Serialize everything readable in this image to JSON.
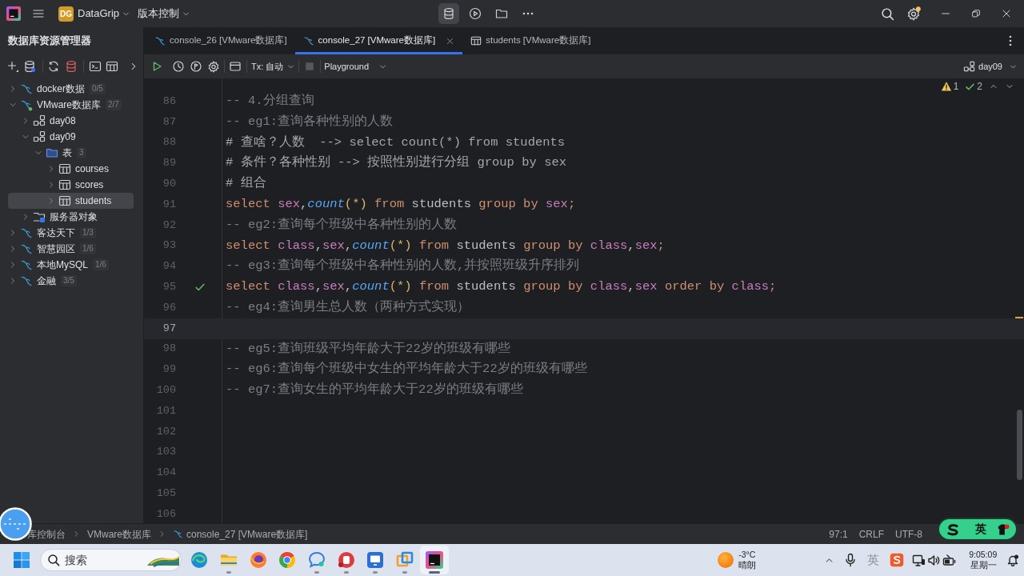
{
  "title_bar": {
    "badge": "DG",
    "project": "DataGrip",
    "menu": "版本控制"
  },
  "explorer": {
    "title": "数据库资源管理器",
    "tree": [
      {
        "kind": "datasource",
        "label": "docker数据",
        "count": "0/5",
        "expanded": false,
        "selected": false,
        "connected": false
      },
      {
        "kind": "datasource",
        "label": "VMware数据库",
        "count": "2/7",
        "expanded": true,
        "selected": false,
        "connected": true,
        "children": [
          {
            "kind": "schema",
            "label": "day08",
            "expanded": false,
            "selected": false
          },
          {
            "kind": "schema",
            "label": "day09",
            "expanded": true,
            "selected": false,
            "children": [
              {
                "kind": "folder",
                "label": "表",
                "count": "3",
                "expanded": true,
                "selected": false,
                "children": [
                  {
                    "kind": "table",
                    "label": "courses",
                    "expanded": false,
                    "selected": false
                  },
                  {
                    "kind": "table",
                    "label": "scores",
                    "expanded": false,
                    "selected": false
                  },
                  {
                    "kind": "table",
                    "label": "students",
                    "expanded": false,
                    "selected": true
                  }
                ]
              }
            ]
          },
          {
            "kind": "server",
            "label": "服务器对象",
            "expanded": false,
            "selected": false
          }
        ]
      },
      {
        "kind": "datasource",
        "label": "客达天下",
        "count": "1/3",
        "expanded": false,
        "selected": false,
        "connected": false
      },
      {
        "kind": "datasource",
        "label": "智慧园区",
        "count": "1/6",
        "expanded": false,
        "selected": false,
        "connected": false
      },
      {
        "kind": "datasource",
        "label": "本地MySQL",
        "count": "1/6",
        "expanded": false,
        "selected": false,
        "connected": false
      },
      {
        "kind": "datasource",
        "label": "金融",
        "count": "3/5",
        "expanded": false,
        "selected": false,
        "connected": false
      }
    ]
  },
  "tabs": [
    {
      "kind": "console",
      "label": "console_26 [VMware数据库]",
      "selected": false
    },
    {
      "kind": "console",
      "label": "console_27 [VMware数据库]",
      "selected": true
    },
    {
      "kind": "table",
      "label": "students [VMware数据库]",
      "selected": false
    }
  ],
  "editor_toolbar": {
    "transaction": "Tx: 自动",
    "mode": "Playground",
    "schema": "day09"
  },
  "inspections": {
    "warnings": "1",
    "passed": "2"
  },
  "lines": [
    {
      "number": "86",
      "current": false,
      "executed": false,
      "tokens": [
        {
          "kind": "comment",
          "text": "-- 4.分组查询"
        }
      ]
    },
    {
      "number": "87",
      "current": false,
      "executed": false,
      "tokens": [
        {
          "kind": "comment",
          "text": "-- eg1:查询各种性别的人数"
        }
      ]
    },
    {
      "number": "88",
      "current": false,
      "executed": false,
      "tokens": [
        {
          "kind": "hash_comment",
          "text": "# 查啥？人数  --> select count(*) from students"
        }
      ]
    },
    {
      "number": "89",
      "current": false,
      "executed": false,
      "tokens": [
        {
          "kind": "hash_comment",
          "text": "# 条件？各种性别 --> 按照性别进行分组 group by sex"
        }
      ]
    },
    {
      "number": "90",
      "current": false,
      "executed": false,
      "tokens": [
        {
          "kind": "hash_comment",
          "text": "# 组合"
        }
      ]
    },
    {
      "number": "91",
      "current": false,
      "executed": false,
      "tokens": [
        {
          "kind": "keyword",
          "text": "select "
        },
        {
          "kind": "column",
          "text": "sex"
        },
        {
          "kind": "plain",
          "text": ","
        },
        {
          "kind": "function",
          "text": "count"
        },
        {
          "kind": "paren",
          "text": "(*)"
        },
        {
          "kind": "keyword",
          "text": " from "
        },
        {
          "kind": "plain",
          "text": "students "
        },
        {
          "kind": "keyword",
          "text": "group by "
        },
        {
          "kind": "column",
          "text": "sex"
        },
        {
          "kind": "keyword",
          "text": ";"
        }
      ]
    },
    {
      "number": "92",
      "current": false,
      "executed": false,
      "tokens": [
        {
          "kind": "comment",
          "text": "-- eg2:查询每个班级中各种性别的人数"
        }
      ]
    },
    {
      "number": "93",
      "current": false,
      "executed": false,
      "tokens": [
        {
          "kind": "keyword",
          "text": "select "
        },
        {
          "kind": "column",
          "text": "class"
        },
        {
          "kind": "plain",
          "text": ","
        },
        {
          "kind": "column",
          "text": "sex"
        },
        {
          "kind": "plain",
          "text": ","
        },
        {
          "kind": "function",
          "text": "count"
        },
        {
          "kind": "paren",
          "text": "(*)"
        },
        {
          "kind": "keyword",
          "text": " from "
        },
        {
          "kind": "plain",
          "text": "students "
        },
        {
          "kind": "keyword",
          "text": "group by "
        },
        {
          "kind": "column",
          "text": "class"
        },
        {
          "kind": "plain",
          "text": ","
        },
        {
          "kind": "column",
          "text": "sex"
        },
        {
          "kind": "keyword",
          "text": ";"
        }
      ]
    },
    {
      "number": "94",
      "current": false,
      "executed": false,
      "tokens": [
        {
          "kind": "comment",
          "text": "-- eg3:查询每个班级中各种性别的人数,并按照班级升序排列"
        }
      ]
    },
    {
      "number": "95",
      "current": false,
      "executed": true,
      "tokens": [
        {
          "kind": "keyword",
          "text": "select "
        },
        {
          "kind": "column",
          "text": "class"
        },
        {
          "kind": "plain",
          "text": ","
        },
        {
          "kind": "column",
          "text": "sex"
        },
        {
          "kind": "plain",
          "text": ","
        },
        {
          "kind": "function",
          "text": "count"
        },
        {
          "kind": "paren",
          "text": "(*)"
        },
        {
          "kind": "keyword",
          "text": " from "
        },
        {
          "kind": "plain",
          "text": "students "
        },
        {
          "kind": "keyword",
          "text": "group by "
        },
        {
          "kind": "column",
          "text": "class"
        },
        {
          "kind": "plain",
          "text": ","
        },
        {
          "kind": "column",
          "text": "sex"
        },
        {
          "kind": "keyword",
          "text": " order by "
        },
        {
          "kind": "column",
          "text": "class"
        },
        {
          "kind": "keyword",
          "text": ";"
        }
      ]
    },
    {
      "number": "96",
      "current": false,
      "executed": false,
      "tokens": [
        {
          "kind": "comment",
          "text": "-- eg4:查询男生总人数（两种方式实现）"
        }
      ]
    },
    {
      "number": "97",
      "current": true,
      "executed": false
    },
    {
      "number": "98",
      "current": false,
      "executed": false,
      "tokens": [
        {
          "kind": "comment",
          "text": "-- eg5:查询班级平均年龄大于22岁的班级有哪些"
        }
      ]
    },
    {
      "number": "99",
      "current": false,
      "executed": false,
      "tokens": [
        {
          "kind": "comment",
          "text": "-- eg6:查询每个班级中女生的平均年龄大于22岁的班级有哪些"
        }
      ]
    },
    {
      "number": "100",
      "current": false,
      "executed": false,
      "tokens": [
        {
          "kind": "comment",
          "text": "-- eg7:查询女生的平均年龄大于22岁的班级有哪些"
        }
      ]
    },
    {
      "number": "101",
      "current": false,
      "executed": false
    },
    {
      "number": "102",
      "current": false,
      "executed": false
    },
    {
      "number": "103",
      "current": false,
      "executed": false
    },
    {
      "number": "104",
      "current": false,
      "executed": false
    },
    {
      "number": "105",
      "current": false,
      "executed": false
    },
    {
      "number": "106",
      "current": false,
      "executed": false
    }
  ],
  "status_bar": {
    "breadcrumbs": [
      {
        "kind": "plain",
        "label": "库控制台"
      },
      {
        "kind": "plain",
        "label": "VMware数据库"
      },
      {
        "kind": "console",
        "label": "console_27 [VMware数据库]"
      }
    ],
    "position": "97:1",
    "line_separator": "CRLF",
    "encoding": "UTF-8"
  },
  "ime_bar": {
    "mode": "英"
  },
  "taskbar": {
    "search": {
      "placeholder": "搜索"
    },
    "apps": [
      {
        "kind": "wave",
        "running": false,
        "selected": false
      },
      {
        "kind": "folder",
        "running": true,
        "selected": false
      },
      {
        "kind": "fox",
        "running": false,
        "selected": false
      },
      {
        "kind": "ring",
        "running": false,
        "selected": false
      },
      {
        "kind": "chat",
        "running": true,
        "selected": false
      },
      {
        "kind": "slides",
        "running": true,
        "selected": false
      },
      {
        "kind": "monitor",
        "running": true,
        "selected": false
      },
      {
        "kind": "squares",
        "running": true,
        "selected": false
      },
      {
        "kind": "ide",
        "running": true,
        "selected": true
      }
    ],
    "weather": {
      "temperature": "-3°C",
      "condition": "晴朗"
    },
    "tray_ime": "英",
    "time": "9:05:09",
    "weekday": "星期一"
  }
}
